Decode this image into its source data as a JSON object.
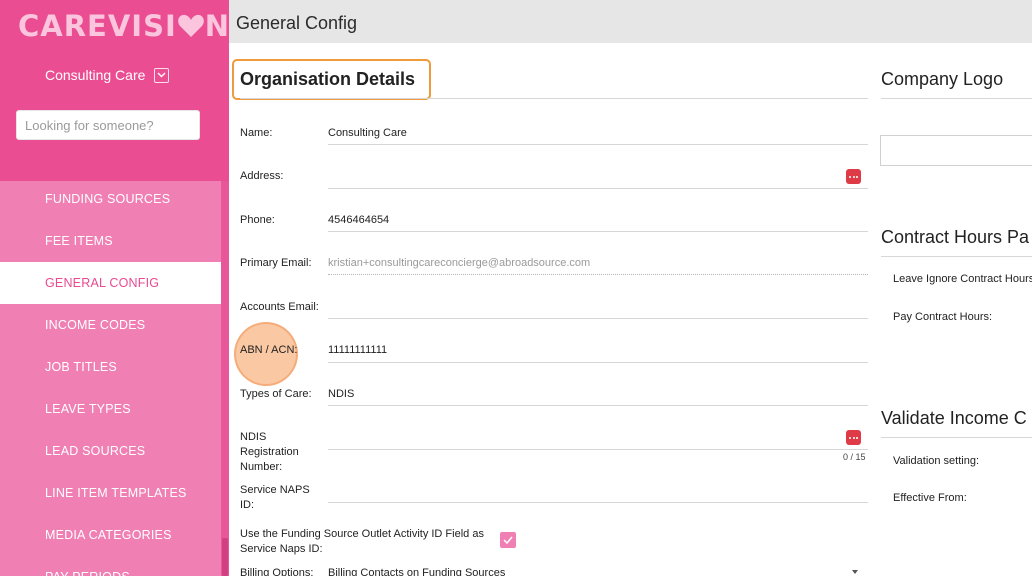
{
  "brand": {
    "logo_text": "CAREVISI",
    "logo_text_end": "N",
    "primary": "#ea4d92",
    "nav_bg": "#f07fb4",
    "accent_orange": "#ef9a3b"
  },
  "sidebar": {
    "org_name": "Consulting Care",
    "search_placeholder": "Looking for someone?",
    "items": [
      {
        "label": "FUNDING SOURCES"
      },
      {
        "label": "FEE ITEMS"
      },
      {
        "label": "GENERAL CONFIG",
        "active": true
      },
      {
        "label": "INCOME CODES"
      },
      {
        "label": "JOB TITLES"
      },
      {
        "label": "LEAVE TYPES"
      },
      {
        "label": "LEAD SOURCES"
      },
      {
        "label": "LINE ITEM TEMPLATES"
      },
      {
        "label": "MEDIA CATEGORIES"
      },
      {
        "label": "PAY PERIODS"
      }
    ]
  },
  "header": {
    "title": "General Config"
  },
  "org_details": {
    "title": "Organisation Details",
    "fields": {
      "name": {
        "label": "Name:",
        "value": "Consulting Care"
      },
      "address": {
        "label": "Address:",
        "value": ""
      },
      "phone": {
        "label": "Phone:",
        "value": "4546464654"
      },
      "primary_email": {
        "label": "Primary Email:",
        "value": "kristian+consultingcareconcierge@abroadsource.com"
      },
      "accounts_email": {
        "label": "Accounts Email:",
        "value": ""
      },
      "abn": {
        "label": "ABN / ACN:",
        "value": "11111111111"
      },
      "types_of_care": {
        "label": "Types of Care:",
        "value": "NDIS"
      },
      "ndis_reg": {
        "label_1": "NDIS",
        "label_2": "Registration",
        "label_3": "Number:",
        "value": "",
        "counter": "0 / 15"
      },
      "service_naps": {
        "label_1": "Service NAPS",
        "label_2": "ID:",
        "value": ""
      },
      "use_funding_source": {
        "label_1": "Use the Funding Source Outlet Activity ID Field as",
        "label_2": "Service Naps ID:",
        "checked": true
      },
      "billing_options": {
        "label": "Billing Options:",
        "value": "Billing Contacts on Funding Sources"
      }
    }
  },
  "right": {
    "company_logo": {
      "title": "Company Logo"
    },
    "contract_hours": {
      "title": "Contract Hours Pa",
      "leave_ignore_label": "Leave Ignore Contract Hours",
      "pay_contract_label": "Pay Contract Hours:"
    },
    "validate_income": {
      "title": "Validate Income C",
      "validation_setting_label": "Validation setting:",
      "effective_from_label": "Effective From:"
    }
  }
}
